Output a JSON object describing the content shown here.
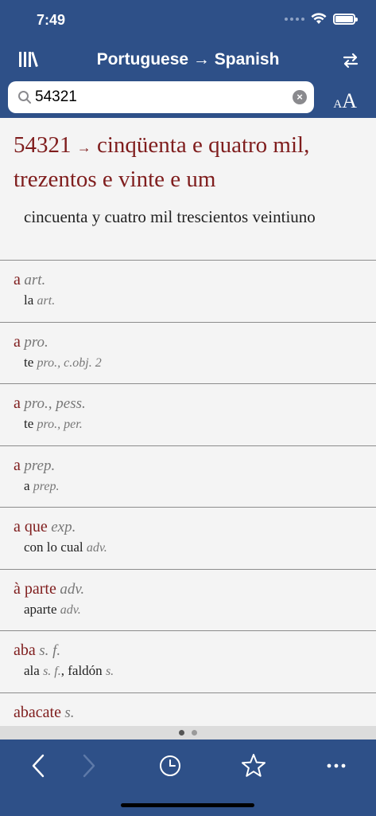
{
  "status": {
    "time": "7:49"
  },
  "nav": {
    "title": "Portuguese → Spanish"
  },
  "search": {
    "value": "54321"
  },
  "font_size": {
    "small": "A",
    "big": "A"
  },
  "main_entry": {
    "term": "54321",
    "arrow": "→",
    "expansion": "cinqüenta e quatro mil, trezentos e vinte e um",
    "translation": "cincuenta y cuatro mil trescientos veintiuno"
  },
  "entries": [
    {
      "term": "a",
      "pos": "art.",
      "trans": "la",
      "trans_pos": "art.",
      "trans_extra": ""
    },
    {
      "term": "a",
      "pos": "pro.",
      "trans": "te",
      "trans_pos": "pro., c.obj. 2",
      "trans_extra": ""
    },
    {
      "term": "a",
      "pos": "pro., pess.",
      "trans": "te",
      "trans_pos": "pro., per.",
      "trans_extra": ""
    },
    {
      "term": "a",
      "pos": "prep.",
      "trans": "a",
      "trans_pos": "prep.",
      "trans_extra": ""
    },
    {
      "term": "a que",
      "pos": "exp.",
      "trans": "con lo cual",
      "trans_pos": "adv.",
      "trans_extra": ""
    },
    {
      "term": "à parte",
      "pos": "adv.",
      "trans": "aparte",
      "trans_pos": "adv.",
      "trans_extra": ""
    },
    {
      "term": "aba",
      "pos": "s. f.",
      "trans": "ala",
      "trans_pos": "s. f.",
      "trans_extra": ", faldón",
      "trans_extra_pos": "s."
    },
    {
      "term": "abacate",
      "pos": "s.",
      "trans": "",
      "trans_pos": "",
      "trans_extra": ""
    }
  ],
  "colors": {
    "bar": "#2e5088",
    "headword": "#7f1d1d"
  },
  "icons": [
    "library-icon",
    "swap-icon",
    "search-icon",
    "clear-icon",
    "back-icon",
    "forward-icon",
    "history-icon",
    "star-icon",
    "more-icon"
  ]
}
